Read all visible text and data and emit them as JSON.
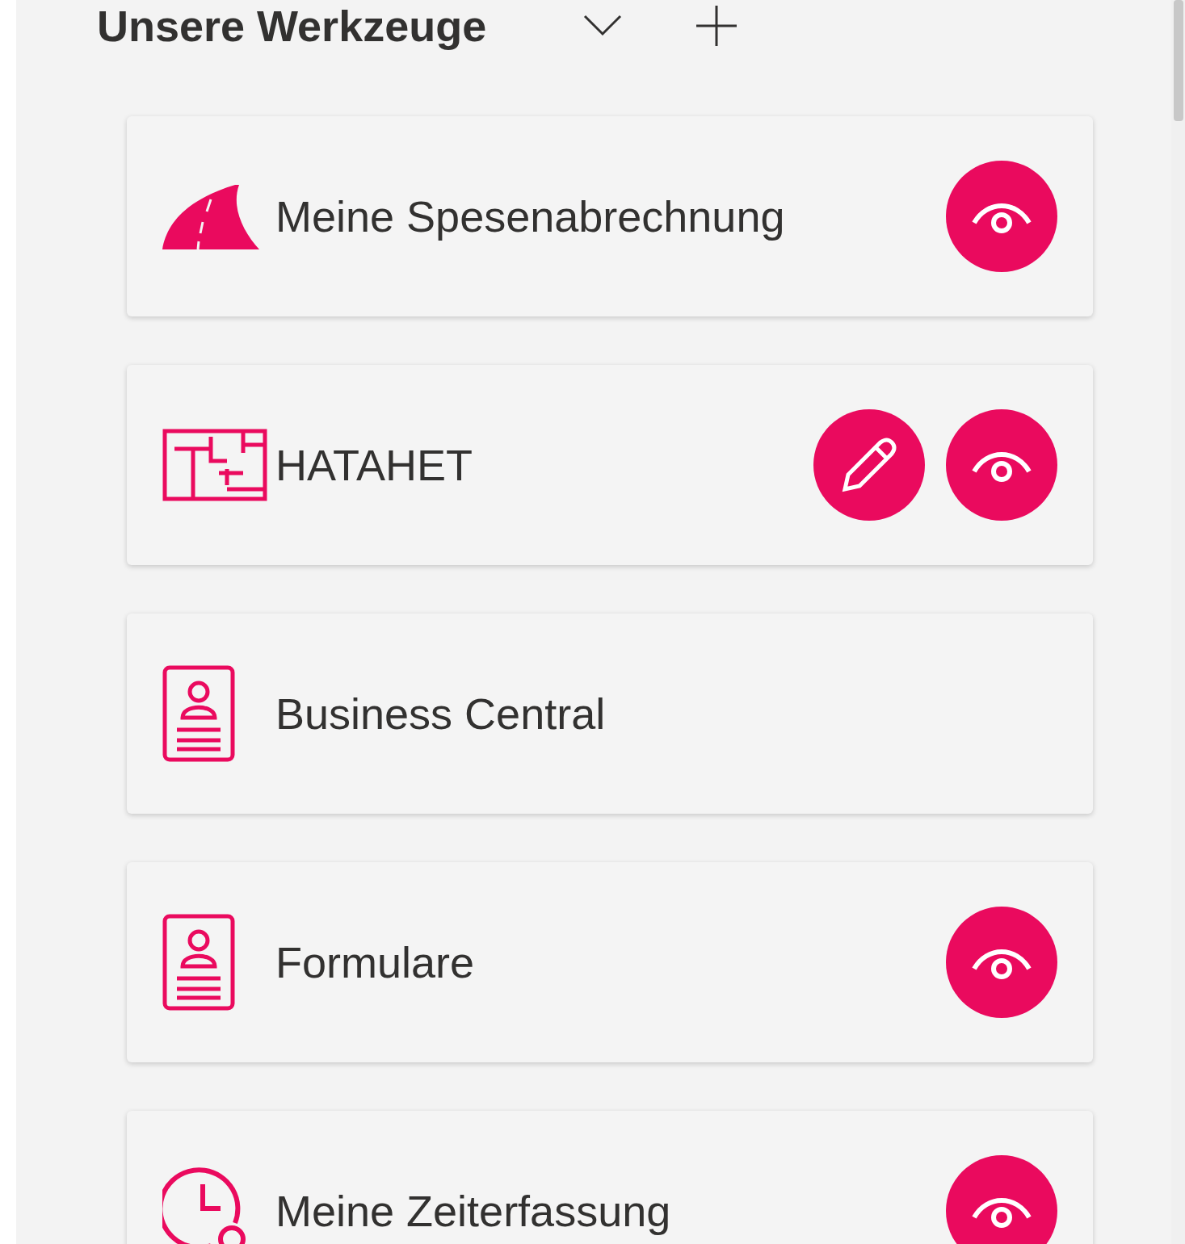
{
  "heading": "Unsere Werkzeuge",
  "tools": [
    {
      "label": "Meine Spesenabrechnung",
      "kind": "road",
      "actions": [
        {
          "kind": "view"
        }
      ]
    },
    {
      "label": "HATAHET",
      "kind": "plan",
      "actions": [
        {
          "kind": "edit"
        },
        {
          "kind": "view"
        }
      ]
    },
    {
      "label": "Business Central",
      "kind": "badge"
    },
    {
      "label": "Formulare",
      "kind": "badge",
      "actions": [
        {
          "kind": "view"
        }
      ]
    },
    {
      "label": "Meine Zeiterfassung",
      "kind": "clock",
      "actions": [
        {
          "kind": "view"
        }
      ]
    }
  ]
}
